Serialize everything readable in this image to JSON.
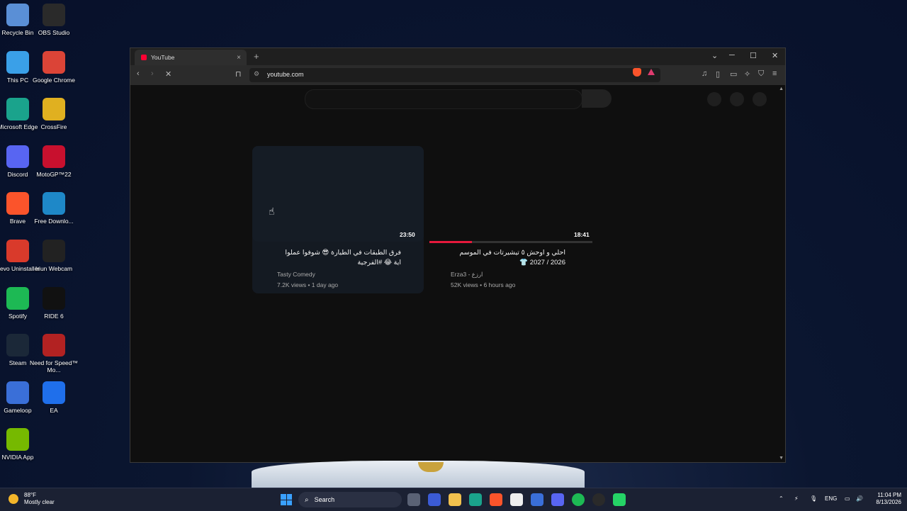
{
  "desktop": {
    "icons": [
      {
        "label": "Recycle Bin",
        "icon": "recycle-bin-icon",
        "color": "#5a8fd6"
      },
      {
        "label": "OBS Studio",
        "icon": "obs-icon",
        "color": "#2a2a2a"
      },
      {
        "label": "This PC",
        "icon": "this-pc-icon",
        "color": "#3aa0e8"
      },
      {
        "label": "Google Chrome",
        "icon": "chrome-icon",
        "color": "#db4437"
      },
      {
        "label": "Microsoft Edge",
        "icon": "edge-icon",
        "color": "#1aa38c"
      },
      {
        "label": "CrossFire",
        "icon": "crossfire-icon",
        "color": "#e0b020"
      },
      {
        "label": "Discord",
        "icon": "discord-icon",
        "color": "#5865f2"
      },
      {
        "label": "MotoGP™22",
        "icon": "motogp-icon",
        "color": "#c8102e"
      },
      {
        "label": "Brave",
        "icon": "brave-icon",
        "color": "#fb542b"
      },
      {
        "label": "Free Downlo...",
        "icon": "free-download-icon",
        "color": "#1e88c8"
      },
      {
        "label": "Revo Uninstaller",
        "icon": "revo-icon",
        "color": "#d93a2b"
      },
      {
        "label": "Iriun Webcam",
        "icon": "iriun-icon",
        "color": "#222222"
      },
      {
        "label": "Spotify",
        "icon": "spotify-icon",
        "color": "#1db954"
      },
      {
        "label": "RIDE 6",
        "icon": "ride6-icon",
        "color": "#111111"
      },
      {
        "label": "Steam",
        "icon": "steam-icon",
        "color": "#1b2838"
      },
      {
        "label": "Need for Speed™ Mo...",
        "icon": "nfs-icon",
        "color": "#b22222"
      },
      {
        "label": "Gameloop",
        "icon": "gameloop-icon",
        "color": "#3a6fd8"
      },
      {
        "label": "EA",
        "icon": "ea-icon",
        "color": "#1f6feb"
      },
      {
        "label": "NVIDIA App",
        "icon": "nvidia-icon",
        "color": "#76b900"
      }
    ]
  },
  "browser": {
    "tab_title": "YouTube",
    "url": "youtube.com",
    "new_tab": "+",
    "close_tab": "×"
  },
  "videos": [
    {
      "title": "فرق الطبقات في الطيارة 😎 شوفوا عملوا اية 😂 #الفرجية",
      "channel": "Tasty Comedy",
      "meta": "7.2K views • 1 day ago",
      "duration": "23:50"
    },
    {
      "title": "احلي و اوحش ٥ تيشيرتات في الموسم 2026 / 2027 👕",
      "channel": "Erza3 - ارزع",
      "meta": "52K views • 6 hours ago",
      "duration": "18:41",
      "progress": 0.26
    }
  ],
  "taskbar": {
    "weather_temp": "88°F",
    "weather_desc": "Mostly clear",
    "search_label": "Search",
    "language": "ENG",
    "time": "11:04 PM",
    "date": "8/13/2026"
  }
}
